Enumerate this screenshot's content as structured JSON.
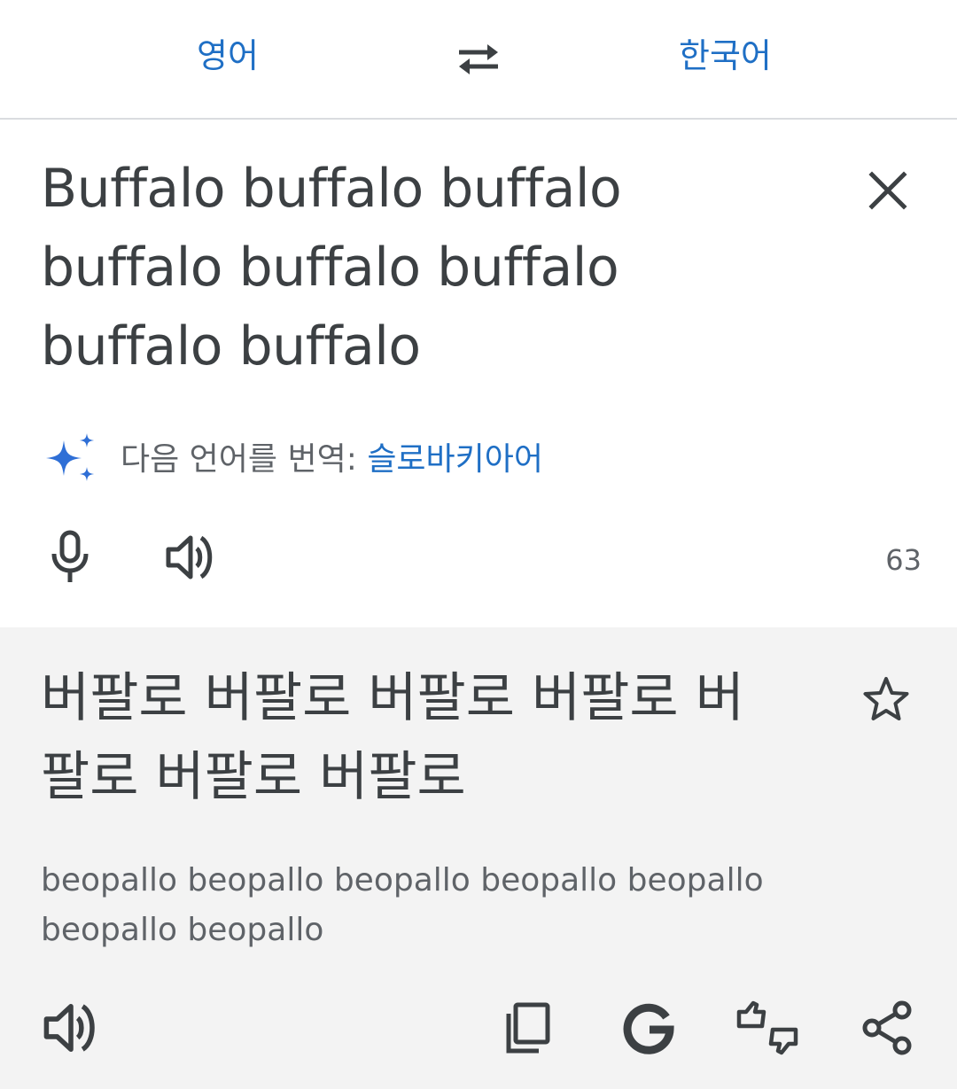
{
  "header": {
    "source_language": "영어",
    "target_language": "한국어",
    "swap_icon": "swap-arrows-icon"
  },
  "input": {
    "text_lines": [
      "Buffalo buffalo buffalo",
      "buffalo buffalo buffalo",
      "buffalo buffalo"
    ],
    "clear_icon": "close-icon",
    "detect_prefix": "다음 언어를 번역: ",
    "detect_language": "슬로바키아어",
    "char_count": "63",
    "icons": [
      "sparkle-icon",
      "microphone-icon",
      "speaker-icon"
    ]
  },
  "output": {
    "text_lines": [
      "버팔로 버팔로 버팔로 버팔로 버",
      "팔로 버팔로 버팔로"
    ],
    "romanization_lines": [
      "beopallo beopallo beopallo beopallo beopallo",
      "beopallo beopallo"
    ],
    "icons": [
      "star-icon",
      "speaker-icon",
      "copy-icon",
      "google-icon",
      "feedback-icon",
      "share-icon"
    ]
  },
  "colors": {
    "accent": "#1f6fc5",
    "text": "#3c4043",
    "secondary_text": "#5f6368",
    "output_bg": "#f3f3f3",
    "divider": "#dadce0"
  }
}
